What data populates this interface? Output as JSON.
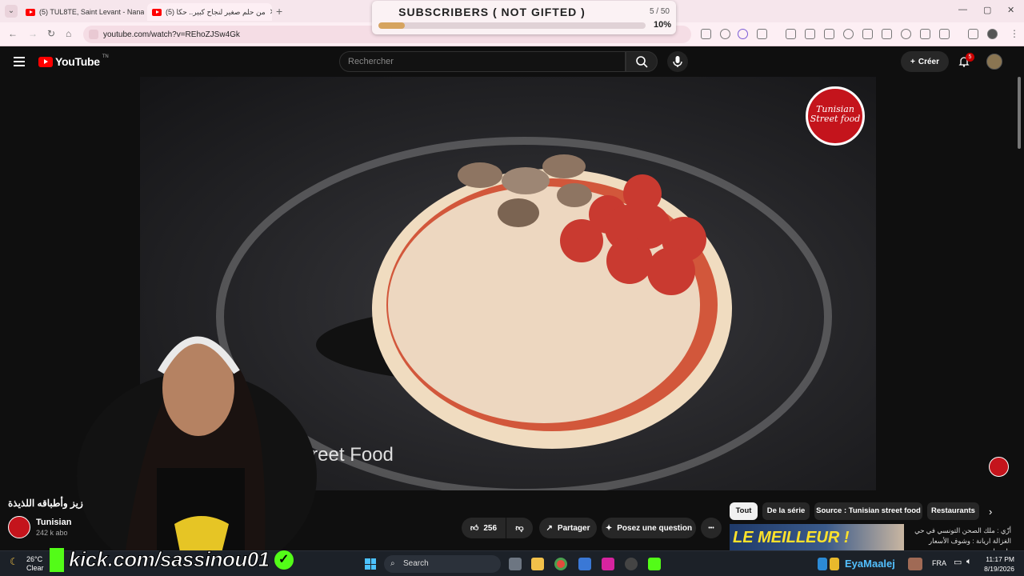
{
  "browser": {
    "tabs": [
      {
        "label": "(5) TUL8TE, Saint Levant - Nana"
      },
      {
        "label": "(5) من حلم صغير لنجاح كبير.. حكا"
      }
    ],
    "url": "youtube.com/watch?v=REhoZJSw4Gk"
  },
  "subscribers_overlay": {
    "title": "SUBSCRIBERS ( NOT GIFTED )",
    "count": "5 / 50",
    "percent_label": "10%",
    "progress": 0.1
  },
  "youtube": {
    "logo_text": "YouTube",
    "logo_tm": "TN",
    "search_placeholder": "Rechercher",
    "create_label": "Créer",
    "notifications_count": "5"
  },
  "video": {
    "watermark": "Tunisian Street Food",
    "channel_badge_text": "Tunisian Street food",
    "title": "زيز وأطباقه اللذيذة",
    "channel_name": "Tunisian",
    "channel_subscribers": "242 k abo",
    "likes": "256",
    "share_label": "Partager",
    "ask_label": "Posez une question",
    "more_label": "•••"
  },
  "chips": [
    {
      "label": "Tout",
      "active": true
    },
    {
      "label": "De la série",
      "active": false
    },
    {
      "label": "Source : Tunisian street food",
      "active": false
    },
    {
      "label": "Restaurants",
      "active": false
    }
  ],
  "recommendation": {
    "thumb_text": "LE MEILLEUR !",
    "title": "أزّي : ملك الصحن التونسي في حي الغزالة اريانة : وشوف الأسعار وارجعلي"
  },
  "stream_overlay": {
    "kick_text": "kick.com/sassinou01"
  },
  "taskbar": {
    "temperature": "26°C",
    "condition": "Clear",
    "search_label": "Search",
    "streamer_name": "EyaMaalej",
    "language": "FRA",
    "time": "11:17 PM",
    "date": "8/19/2026"
  },
  "colors": {
    "youtube_red": "#ff0000",
    "kick_green": "#53fc18",
    "progress_fill": "#d6a45f"
  }
}
